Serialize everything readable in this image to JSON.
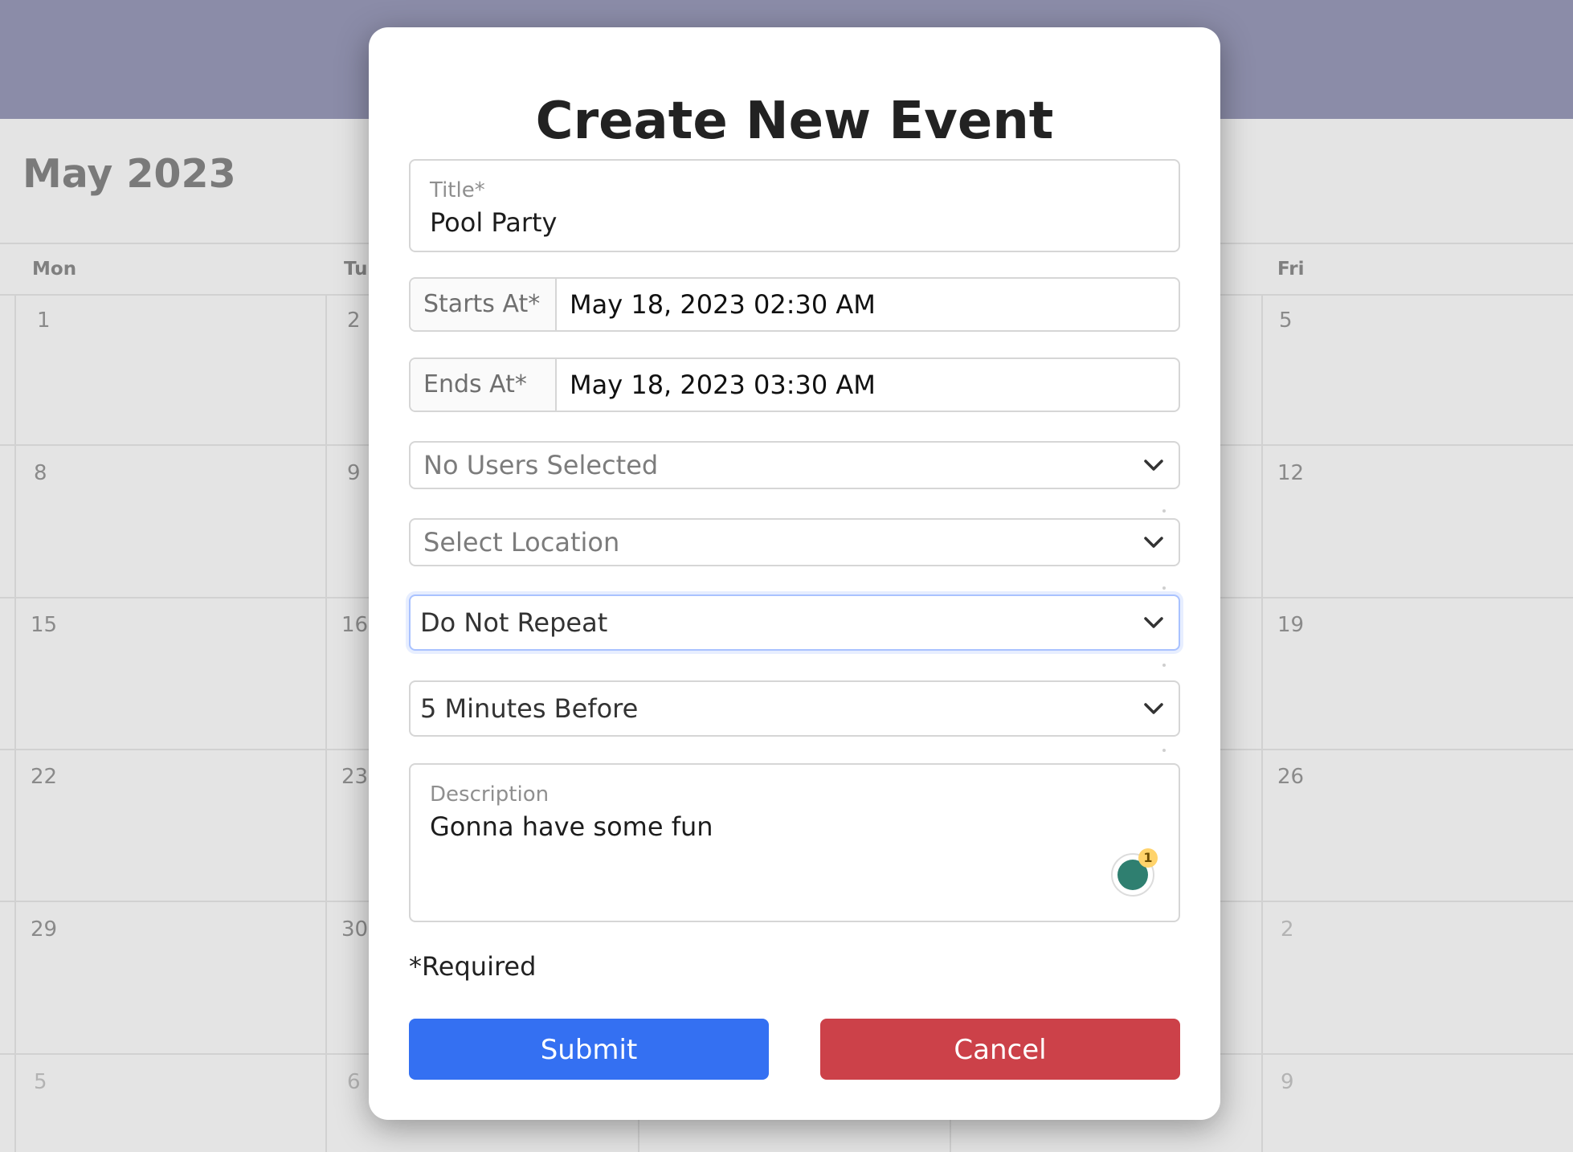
{
  "header": {
    "title": ""
  },
  "calendar": {
    "month_title": "May 2023",
    "weekdays": [
      "Mon",
      "Tu",
      "Fri"
    ],
    "days_col1": [
      "1",
      "8",
      "15",
      "22",
      "29",
      "5"
    ],
    "days_col2": [
      "2",
      "9",
      "16",
      "23",
      "30",
      "6"
    ],
    "days_col5": [
      "5",
      "12",
      "19",
      "26",
      "2",
      "9"
    ]
  },
  "modal": {
    "title": "Create New Event",
    "title_field": {
      "label": "Title*",
      "value": "Pool Party"
    },
    "starts_at": {
      "label": "Starts At*",
      "value": "May 18, 2023 02:30 AM"
    },
    "ends_at": {
      "label": "Ends At*",
      "value": "May 18, 2023 03:30 AM"
    },
    "users_select": {
      "value": "No Users Selected"
    },
    "location_select": {
      "value": "Select Location"
    },
    "repeat_select": {
      "value": "Do Not Repeat"
    },
    "reminder_select": {
      "value": "5 Minutes Before"
    },
    "description": {
      "label": "Description",
      "value": "Gonna have some fun"
    },
    "grammarly_badge": "1",
    "required_note": "*Required",
    "submit_label": "Submit",
    "cancel_label": "Cancel"
  },
  "colors": {
    "header_bg": "#8b8ca8",
    "submit": "#3470f2",
    "cancel": "#cc4149",
    "focus_ring": "#a9c2ff"
  },
  "icons": [
    "chevron-down-icon",
    "grammarly-icon"
  ]
}
